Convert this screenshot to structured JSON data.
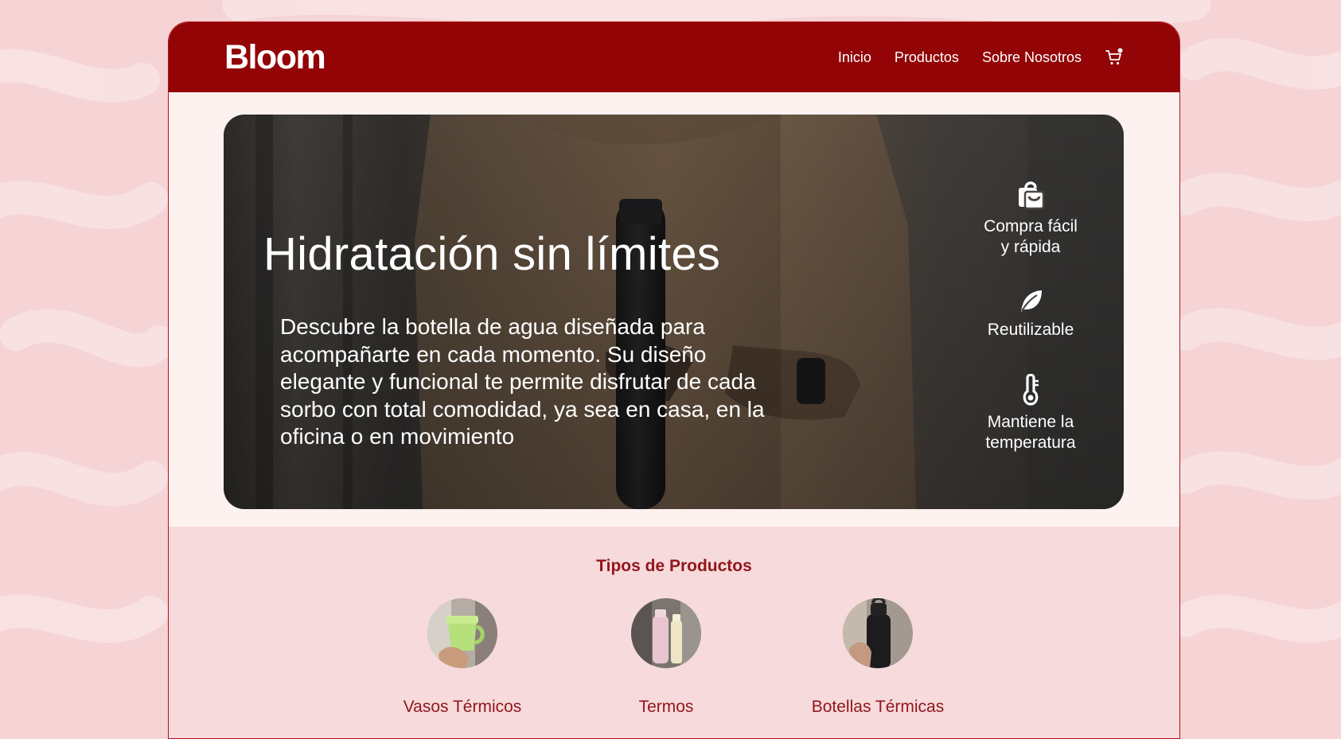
{
  "nav": {
    "logo": "Bloom",
    "links": [
      "Inicio",
      "Productos",
      "Sobre Nosotros"
    ],
    "cart_icon": "cart-icon"
  },
  "hero": {
    "title": "Hidratación sin límites",
    "description": "Descubre la botella de agua diseñada para acompañarte en cada momento. Su diseño elegante y funcional te permite disfrutar de cada sorbo con total comodidad, ya sea en casa, en la oficina o en movimiento",
    "features": [
      {
        "icon": "shopping-bag-icon",
        "label_lines": [
          "Compra fácil",
          "y rápida"
        ]
      },
      {
        "icon": "leaf-icon",
        "label_lines": [
          "Reutilizable"
        ]
      },
      {
        "icon": "thermometer-icon",
        "label_lines": [
          "Mantiene la",
          "temperatura"
        ]
      }
    ]
  },
  "products": {
    "title": "Tipos de Productos",
    "items": [
      {
        "label": "Vasos Térmicos"
      },
      {
        "label": "Termos"
      },
      {
        "label": "Botellas Térmicas"
      }
    ]
  },
  "colors": {
    "brand": "#920406",
    "accent_text": "#92161b",
    "page_background": "#f6d3d5",
    "content_background": "#fdf2f0",
    "section_background": "#f6dadc"
  }
}
